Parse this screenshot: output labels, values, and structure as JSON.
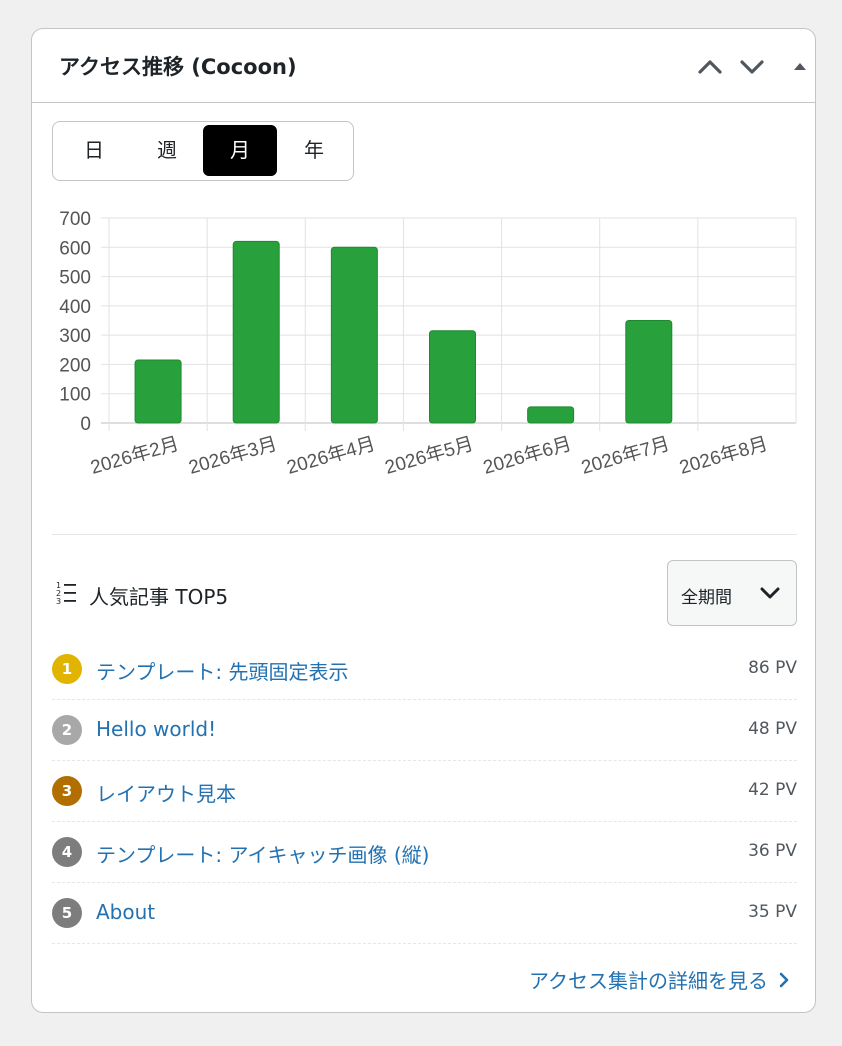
{
  "header": {
    "title": "アクセス推移 (Cocoon)"
  },
  "period_tabs": [
    {
      "label": "日",
      "active": false
    },
    {
      "label": "週",
      "active": false
    },
    {
      "label": "月",
      "active": true
    },
    {
      "label": "年",
      "active": false
    }
  ],
  "chart_data": {
    "type": "bar",
    "categories": [
      "2026年2月",
      "2026年3月",
      "2026年4月",
      "2026年5月",
      "2026年6月",
      "2026年7月",
      "2026年8月"
    ],
    "values": [
      215,
      620,
      600,
      315,
      55,
      350,
      0
    ],
    "ylim": [
      0,
      700
    ],
    "yticks": [
      "0",
      "100",
      "200",
      "300",
      "400",
      "500",
      "600",
      "700"
    ],
    "color": "#28a03c",
    "grid": true
  },
  "ranking": {
    "title": "人気記事 TOP5",
    "range_label": "全期間",
    "items": [
      {
        "rank": "1",
        "title": "テンプレート: 先頭固定表示",
        "pv": "86 PV",
        "badge_color": "#e0b400"
      },
      {
        "rank": "2",
        "title": "Hello world!",
        "pv": "48 PV",
        "badge_color": "#a8a8a8"
      },
      {
        "rank": "3",
        "title": "レイアウト見本",
        "pv": "42 PV",
        "badge_color": "#b06f00"
      },
      {
        "rank": "4",
        "title": "テンプレート: アイキャッチ画像 (縦)",
        "pv": "36 PV",
        "badge_color": "#7d7d7d"
      },
      {
        "rank": "5",
        "title": "About",
        "pv": "35 PV",
        "badge_color": "#7d7d7d"
      }
    ]
  },
  "footer": {
    "details_link": "アクセス集計の詳細を見る"
  },
  "icons": {
    "move_up": "chevron-up-icon",
    "move_down": "chevron-down-icon",
    "toggle": "triangle-up-icon",
    "ranking": "ordered-list-icon",
    "select_caret": "chevron-down-icon",
    "link_arrow": "chevron-right-icon"
  }
}
